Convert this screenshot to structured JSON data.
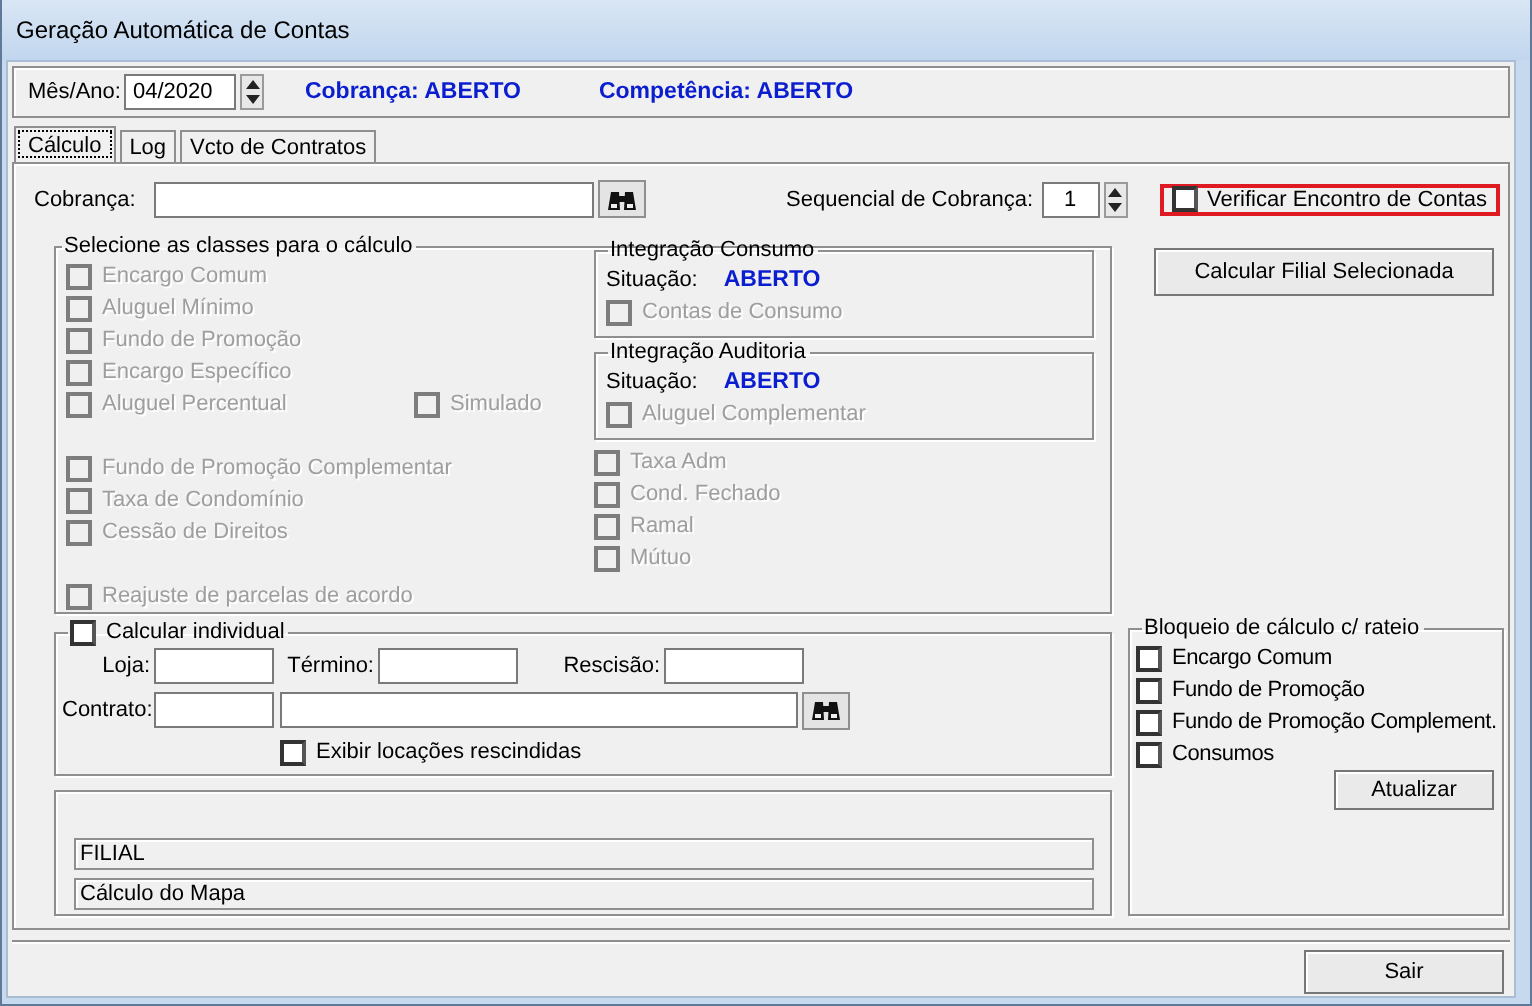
{
  "window": {
    "title": "Geração Automática de Contas"
  },
  "header": {
    "month_label": "Mês/Ano:",
    "month_value": "04/2020",
    "statuses": [
      {
        "text": "Cobrança: ABERTO"
      },
      {
        "text": "Competência: ABERTO"
      }
    ]
  },
  "tabs": [
    {
      "label": "Cálculo",
      "selected": true
    },
    {
      "label": "Log",
      "selected": false
    },
    {
      "label": "Vcto de Contratos",
      "selected": false
    }
  ],
  "cobranca": {
    "label": "Cobrança:",
    "sequencial_label": "Sequencial de Cobrança:",
    "sequencial_value": "1",
    "verificar": {
      "label": "Verificar Encontro de Contas",
      "checked": false,
      "highlighted": true
    }
  },
  "classes": {
    "title": "Selecione as classes para o cálculo",
    "groups": [
      {
        "items": [
          {
            "label": "Encargo Comum",
            "checked": false,
            "disabled": true
          },
          {
            "label": "Aluguel Mínimo",
            "checked": false,
            "disabled": true
          },
          {
            "label": "Fundo de Promoção",
            "checked": false,
            "disabled": true
          },
          {
            "label": "Encargo Específico",
            "checked": false,
            "disabled": true
          },
          {
            "label": "Aluguel Percentual",
            "checked": false,
            "disabled": true
          }
        ]
      },
      {
        "items": [
          {
            "label": "Fundo de Promoção Complementar",
            "checked": false,
            "disabled": true
          },
          {
            "label": "Taxa de Condomínio",
            "checked": false,
            "disabled": true
          },
          {
            "label": "Cessão de Direitos",
            "checked": false,
            "disabled": true
          }
        ]
      },
      {
        "items": [
          {
            "label": "Reajuste de parcelas de acordo",
            "checked": false,
            "disabled": true
          }
        ]
      }
    ],
    "simulado": {
      "label": "Simulado",
      "checked": false,
      "disabled": true
    },
    "integrations": [
      {
        "title": "Integração Consumo",
        "situacao_label": "Situação:",
        "status": "ABERTO",
        "option": {
          "label": "Contas de Consumo",
          "checked": false,
          "disabled": true
        }
      },
      {
        "title": "Integração Auditoria",
        "situacao_label": "Situação:",
        "status": "ABERTO",
        "option": {
          "label": "Aluguel Complementar",
          "checked": false,
          "disabled": true
        }
      }
    ],
    "extras": [
      {
        "label": "Taxa Adm",
        "checked": false,
        "disabled": true
      },
      {
        "label": "Cond. Fechado",
        "checked": false,
        "disabled": true
      },
      {
        "label": "Ramal",
        "checked": false,
        "disabled": true
      },
      {
        "label": "Mútuo",
        "checked": false,
        "disabled": true
      }
    ]
  },
  "calcular_filial_button": "Calcular Filial Selecionada",
  "individual": {
    "label": "Calcular individual",
    "checked": false,
    "loja_label": "Loja:",
    "termino_label": "Término:",
    "rescisao_label": "Rescisão:",
    "contrato_label": "Contrato:",
    "exibir": {
      "label": "Exibir locações rescindidas",
      "checked": false
    }
  },
  "progress": {
    "lines": [
      "FILIAL",
      "Cálculo do Mapa"
    ]
  },
  "bloqueio": {
    "title": "Bloqueio de cálculo c/ rateio",
    "items": [
      {
        "label": "Encargo Comum",
        "checked": false
      },
      {
        "label": "Fundo de Promoção",
        "checked": false
      },
      {
        "label": "Fundo de Promoção Complement.",
        "checked": false
      },
      {
        "label": "Consumos",
        "checked": false
      }
    ],
    "button": "Atualizar"
  },
  "exit_button": "Sair"
}
